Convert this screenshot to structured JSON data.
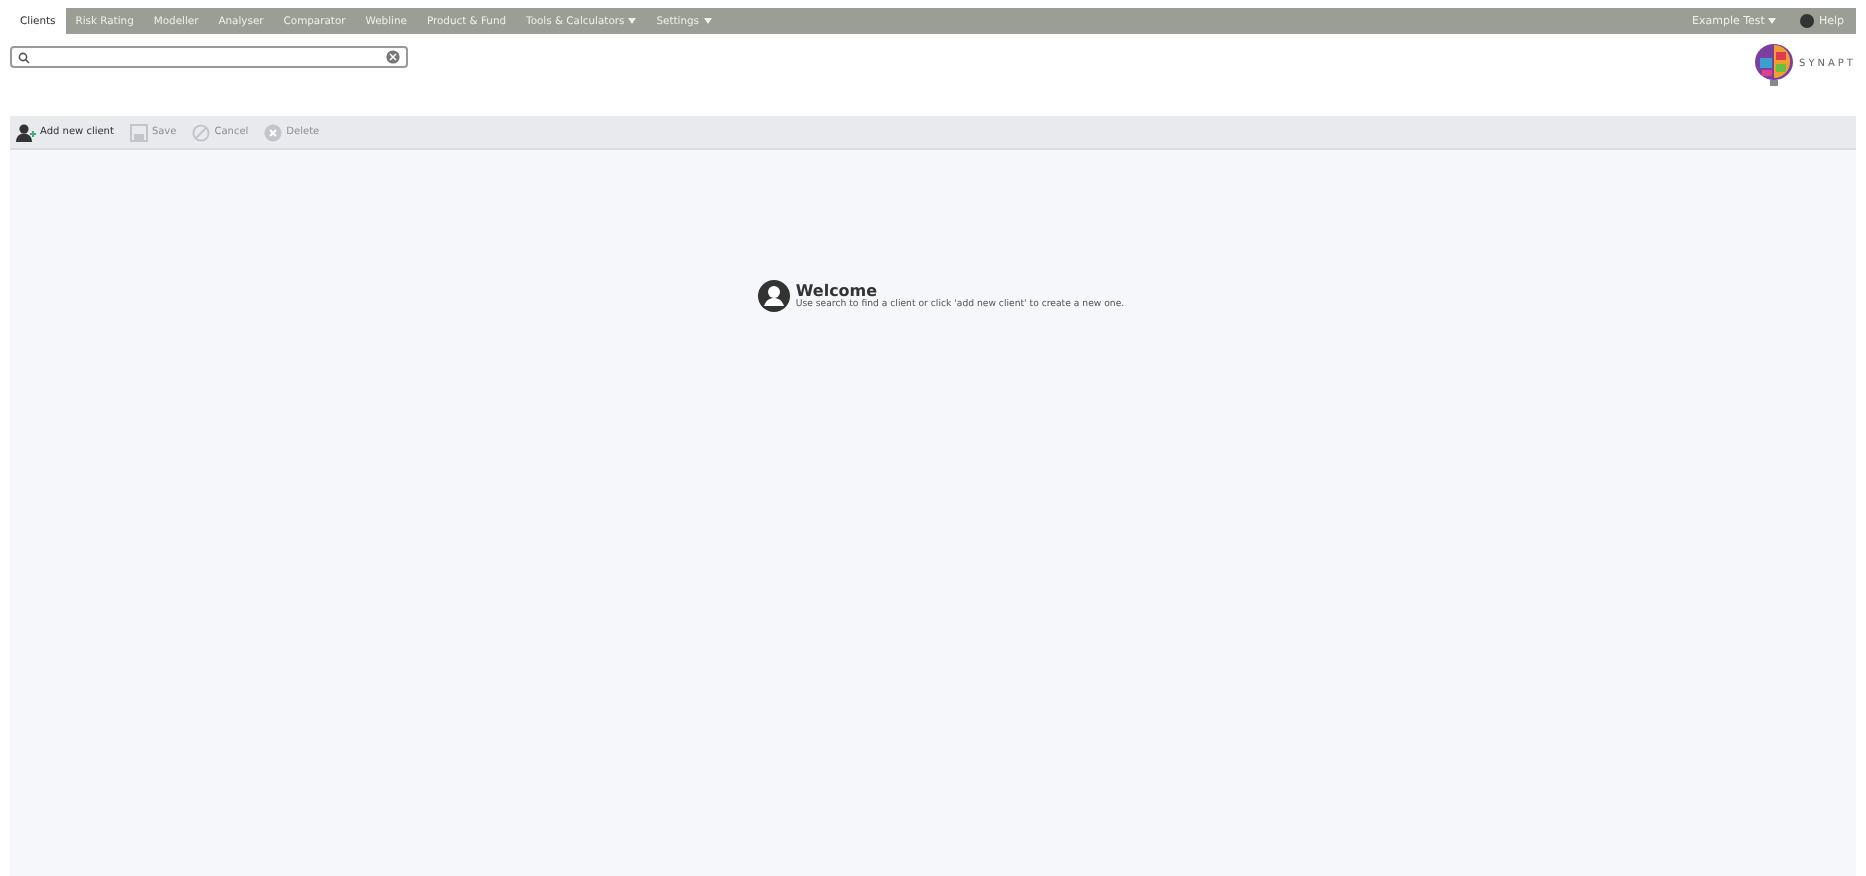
{
  "nav": {
    "tabs": [
      {
        "label": "Clients",
        "selected": true,
        "dropdown": false
      },
      {
        "label": "Risk Rating",
        "selected": false,
        "dropdown": false
      },
      {
        "label": "Modeller",
        "selected": false,
        "dropdown": false
      },
      {
        "label": "Analyser",
        "selected": false,
        "dropdown": false
      },
      {
        "label": "Comparator",
        "selected": false,
        "dropdown": false
      },
      {
        "label": "Webline",
        "selected": false,
        "dropdown": false
      },
      {
        "label": "Product & Fund",
        "selected": false,
        "dropdown": false
      },
      {
        "label": "Tools & Calculators",
        "selected": false,
        "dropdown": true
      },
      {
        "label": "Settings",
        "selected": false,
        "dropdown": true
      }
    ],
    "user": "Example Test",
    "help": "Help"
  },
  "brand": "SYNAPT",
  "toolbar": [
    {
      "label": "Add new client",
      "kind": "add",
      "disabled": false
    },
    {
      "label": "Save",
      "kind": "save",
      "disabled": true
    },
    {
      "label": "Cancel",
      "kind": "cancel",
      "disabled": true
    },
    {
      "label": "Delete",
      "kind": "delete",
      "disabled": true
    }
  ],
  "welcome": {
    "title": "Welcome",
    "text": "Use search to find a client or click 'add new client' to create a new one."
  }
}
